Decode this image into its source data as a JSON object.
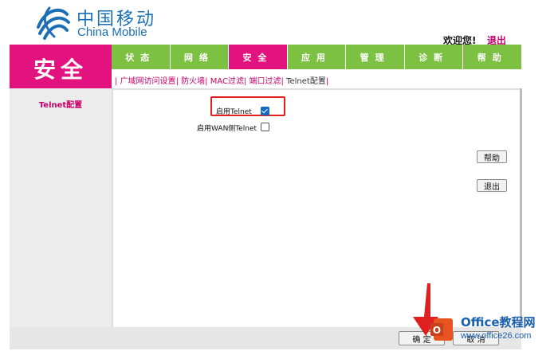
{
  "brand": {
    "name_cn": "中国移动",
    "name_en": "China Mobile",
    "logo_color": "#1a6fb5"
  },
  "header": {
    "welcome": "欢迎您!",
    "logout": "退出"
  },
  "section": {
    "title": "安全",
    "color": "#e2127e"
  },
  "nav": {
    "tabs": [
      {
        "label": "状态",
        "active": false
      },
      {
        "label": "网络",
        "active": false
      },
      {
        "label": "安全",
        "active": true
      },
      {
        "label": "应用",
        "active": false
      },
      {
        "label": "管理",
        "active": false
      },
      {
        "label": "诊断",
        "active": false
      },
      {
        "label": "帮助",
        "active": false
      }
    ],
    "tab_color": "#7dc142"
  },
  "subnav": {
    "items": [
      "广域网访问设置",
      "防火墙",
      "MAC过滤",
      "端口过滤",
      "Telnet配置"
    ],
    "current": "Telnet配置"
  },
  "sidebar": {
    "item": "Telnet配置"
  },
  "form": {
    "enable_telnet_label": "启用Telnet",
    "enable_telnet_checked": true,
    "enable_wan_telnet_label": "启用WAN侧Telnet",
    "enable_wan_telnet_checked": false
  },
  "buttons": {
    "help": "帮助",
    "exit": "退出",
    "confirm": "确 定",
    "cancel": "取 消"
  },
  "watermark": {
    "title": "Office教程网",
    "url": "www.office26.com"
  }
}
